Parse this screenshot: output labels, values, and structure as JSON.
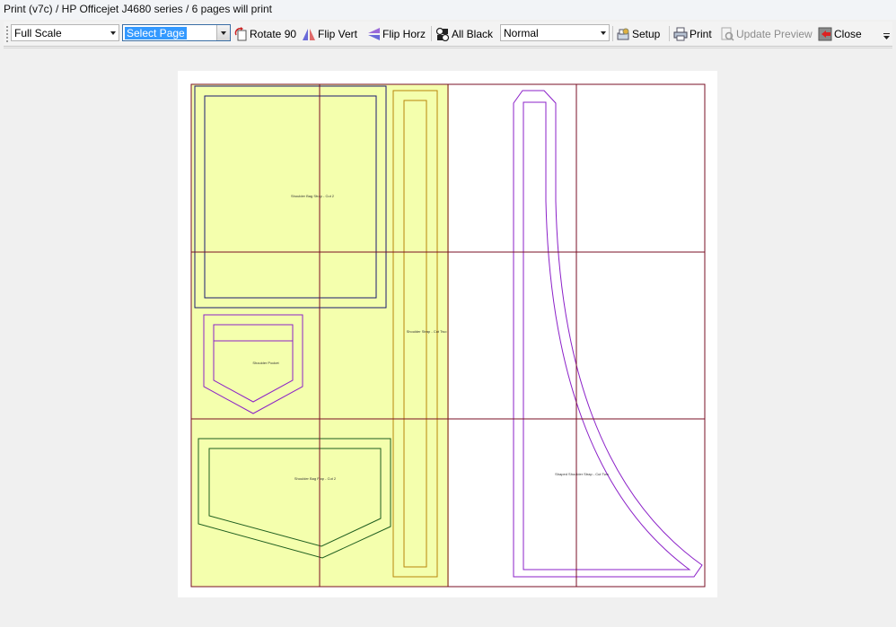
{
  "window": {
    "title": "Print (v7c)  /  HP Officejet J4680 series  /  6 pages will print"
  },
  "toolbar": {
    "scale_select": "Full Scale",
    "page_select": "Select Page",
    "rotate_label": "Rotate 90",
    "flip_vert_label": "Flip Vert",
    "flip_horz_label": "Flip Horz",
    "all_black_label": "All Black",
    "mode_select": "Normal",
    "setup_label": "Setup",
    "print_label": "Print",
    "update_preview_label": "Update Preview",
    "close_label": "Close"
  },
  "preview": {
    "pieces": {
      "strap_cut2": "Shoulder Bag Strap - Cut 2",
      "strap_cut_two": "Shoulder Strap - Cut Two",
      "pocket": "Shoulder Pocket",
      "flap_cut2": "Shoulder Bag Flap - Cut 2",
      "shaped_strap": "Shaped Shoulder Strap - Cut Two"
    }
  },
  "colors": {
    "highlight": "#3399ff",
    "page_grid": "#7a0f24",
    "fabric_fill": "#f4ffad",
    "outline_navy": "#1a1a6e",
    "outline_purple": "#8b20c8",
    "outline_green": "#1e5e1e",
    "outline_gold": "#b8860b"
  },
  "icons": [
    "rotate-icon",
    "flip-vert-icon",
    "flip-horz-icon",
    "all-black-icon",
    "setup-icon",
    "print-icon",
    "update-preview-icon",
    "close-icon"
  ]
}
